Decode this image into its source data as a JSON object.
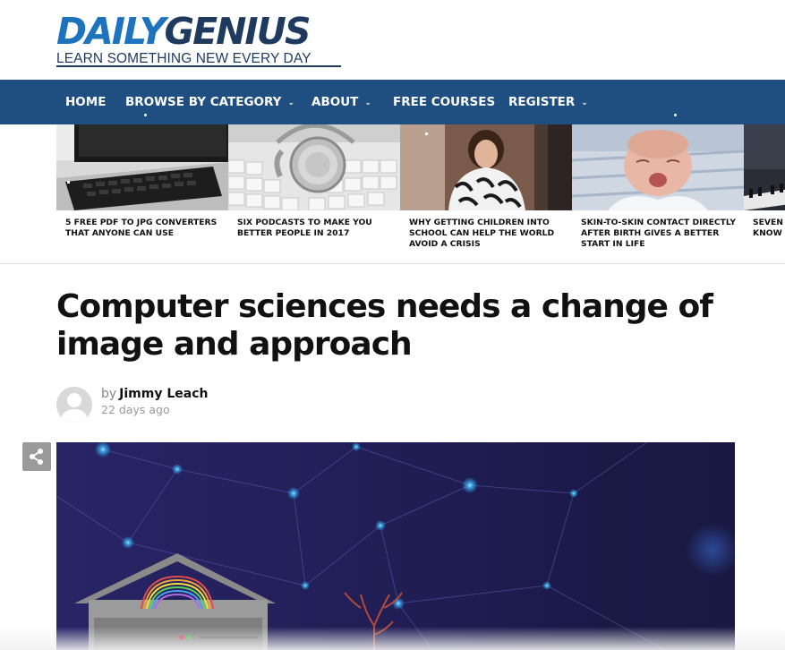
{
  "site": {
    "logo_daily": "DAILY",
    "logo_genius": "GENIUS",
    "tagline": "LEARN SOMETHING NEW EVERY DAY"
  },
  "nav": {
    "items": [
      {
        "label": "HOME",
        "has_dropdown": false
      },
      {
        "label": "BROWSE BY CATEGORY",
        "has_dropdown": true
      },
      {
        "label": "ABOUT",
        "has_dropdown": true
      },
      {
        "label": "FREE COURSES",
        "has_dropdown": false
      },
      {
        "label": "REGISTER",
        "has_dropdown": true
      }
    ],
    "chevron": "⌄"
  },
  "carousel": {
    "cards": [
      {
        "caption": "5 FREE PDF TO JPG CONVERTERS THAT ANYONE CAN USE",
        "image": "computer-keyboard-monitor"
      },
      {
        "caption": "SIX PODCASTS TO MAKE YOU BETTER PEOPLE IN 2017",
        "image": "headphones-on-keyboard"
      },
      {
        "caption": "WHY GETTING CHILDREN INTO SCHOOL CAN HELP THE WORLD AVOID A CRISIS",
        "image": "woman-speaker"
      },
      {
        "caption": "SKIN-TO-SKIN CONTACT DIRECTLY AFTER BIRTH GIVES A BETTER START IN LIFE",
        "image": "newborn-baby"
      },
      {
        "caption": "SEVEN THINGS YOU SHOULD KNOW ABOUT INSTRUMENTS",
        "image": "piano-keys"
      }
    ]
  },
  "article": {
    "title": "Computer sciences needs a change of image and approach",
    "by_prefix": "by",
    "author": "Jimmy Leach",
    "date": "22 days ago",
    "hero_image": "network-illustration"
  },
  "share": {
    "icon": "share-icon"
  },
  "colors": {
    "nav_bg": "#1f4e80",
    "logo_blue": "#1e73be",
    "logo_navy": "#1e3a5f",
    "hero_bg": "#221e55"
  }
}
